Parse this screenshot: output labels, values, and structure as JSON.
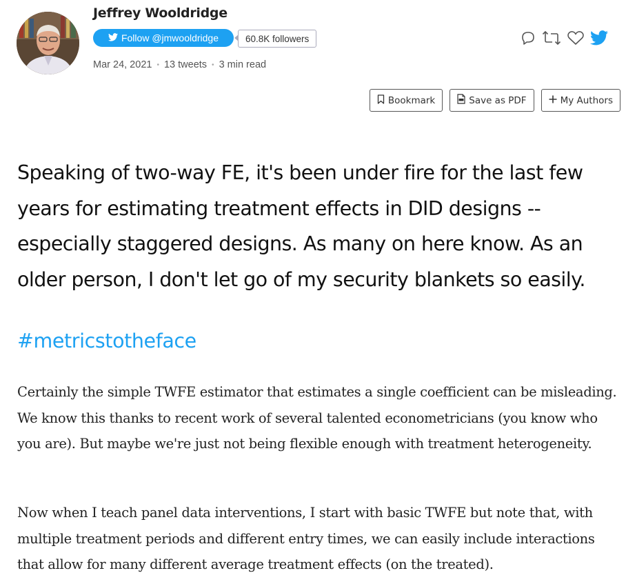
{
  "author": {
    "name": "Jeffrey Wooldridge",
    "follow_label": "Follow @jmwooldridge",
    "followers": "60.8K followers"
  },
  "meta": {
    "date": "Mar 24, 2021",
    "tweets": "13 tweets",
    "read_time": "3 min read"
  },
  "toolbar": {
    "bookmark": "Bookmark",
    "save_pdf": "Save as PDF",
    "my_authors": "My Authors"
  },
  "icons": {
    "reply": "reply-icon",
    "retweet": "retweet-icon",
    "like": "like-icon",
    "twitter": "twitter-bird-icon"
  },
  "colors": {
    "accent": "#1da1f2",
    "icon_gray": "#555555"
  },
  "content": {
    "intro": "Speaking of two-way FE, it's been under fire for the last few years for estimating treatment effects in DID designs -- especially staggered designs. As many on here know. As an older person, I don't let go of my security blankets so easily.",
    "hashtag": "#metricstotheface",
    "paragraph1": "Certainly the simple TWFE estimator that estimates a single coefficient can be misleading. We know this thanks to recent work of several talented econometricians (you know who you are). But maybe we're just not being flexible enough with treatment heterogeneity.",
    "paragraph2": "Now when I teach panel data interventions, I start with basic TWFE but note that, with multiple treatment periods and different entry times, we can easily include interactions that allow for many different average treatment effects (on the treated)."
  }
}
